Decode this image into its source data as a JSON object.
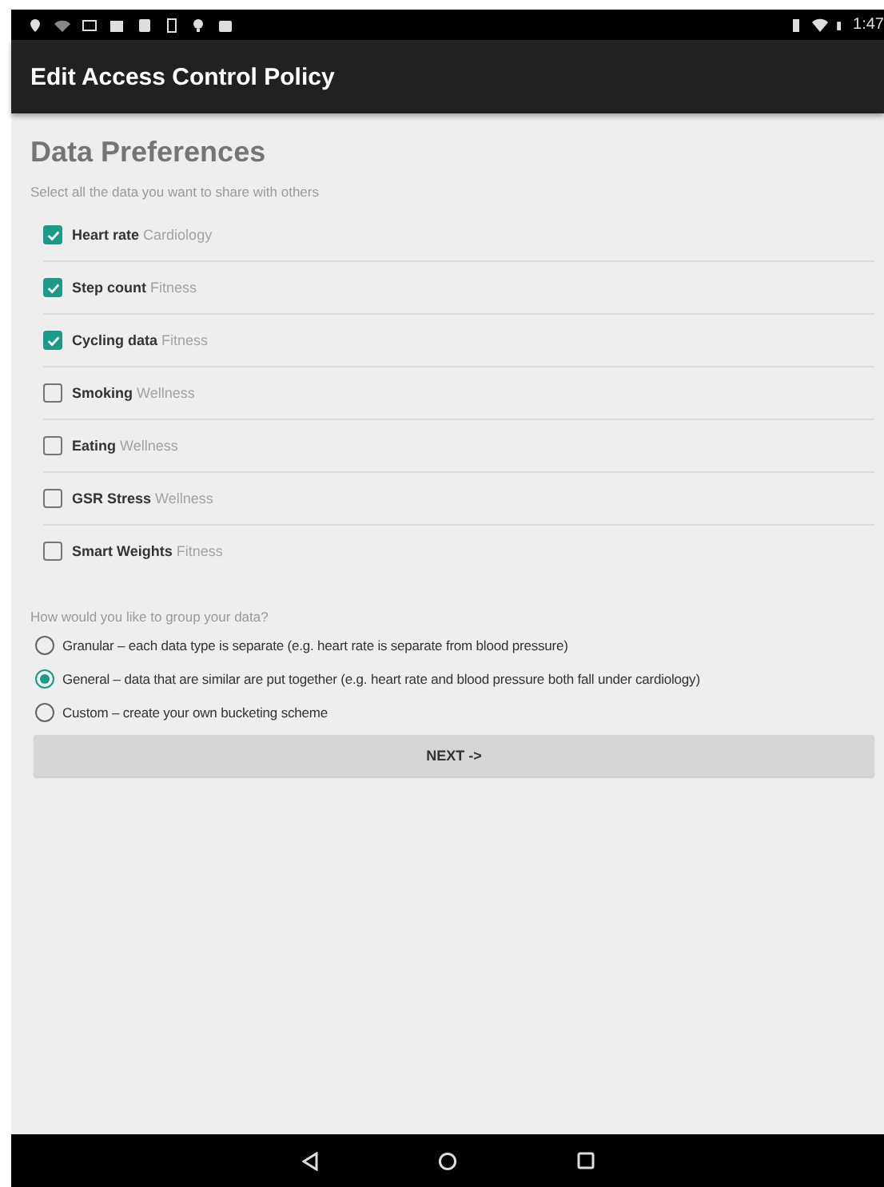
{
  "status_bar": {
    "time": "1:47"
  },
  "app_bar": {
    "title": "Edit Access Control Policy"
  },
  "heading": "Data Preferences",
  "subtitle": "Select all the data you want to share with others",
  "data_items": [
    {
      "name": "Heart rate",
      "category": "Cardiology",
      "checked": true
    },
    {
      "name": "Step count",
      "category": "Fitness",
      "checked": true
    },
    {
      "name": "Cycling data",
      "category": "Fitness",
      "checked": true
    },
    {
      "name": "Smoking",
      "category": "Wellness",
      "checked": false
    },
    {
      "name": "Eating",
      "category": "Wellness",
      "checked": false
    },
    {
      "name": "GSR Stress",
      "category": "Wellness",
      "checked": false
    },
    {
      "name": "Smart Weights",
      "category": "Fitness",
      "checked": false
    }
  ],
  "group_question": "How would you like to group your data?",
  "group_options": [
    {
      "label": "Granular – each data type is separate (e.g. heart rate is separate from blood pressure)",
      "selected": false
    },
    {
      "label": "General – data that are similar are put together (e.g. heart rate and blood pressure both fall under cardiology)",
      "selected": true
    },
    {
      "label": "Custom – create your own bucketing scheme",
      "selected": false
    }
  ],
  "next_button": "NEXT ->"
}
